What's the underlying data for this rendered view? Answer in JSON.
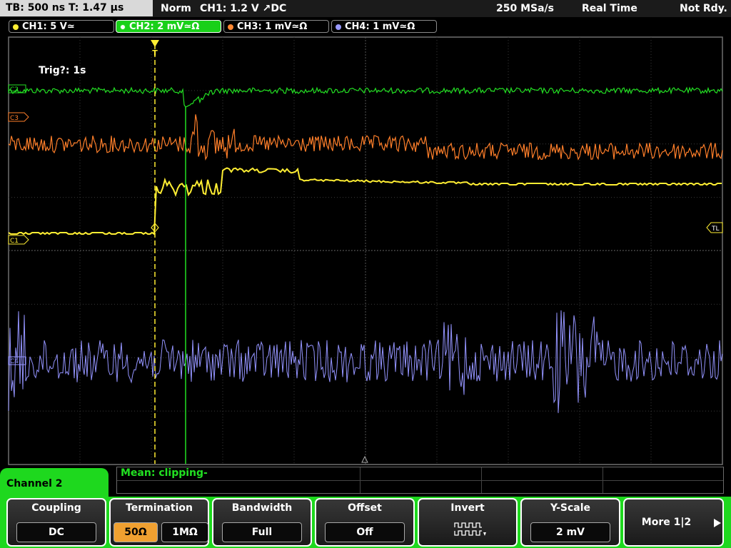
{
  "top": {
    "timebase": "TB: 500 ns   T: 1.47 µs",
    "mode": "Norm",
    "trigger": "CH1: 1.2 V ↗DC",
    "sample_rate": "250 MSa/s",
    "acq": "Real Time",
    "status": "Not Rdy."
  },
  "channels": [
    {
      "label": "CH1: 5 V≃",
      "color": "#ffee33"
    },
    {
      "label": "CH2: 2 mV≃Ω",
      "color": "#22e022"
    },
    {
      "label": "CH3: 1 mV≃Ω",
      "color": "#ff8833"
    },
    {
      "label": "CH4: 1 mV≃Ω",
      "color": "#9999ff"
    }
  ],
  "screen": {
    "trig_text": "Trig?: 1s",
    "c1_marker": "C1",
    "c2_marker": "C2",
    "c3_marker": "C3",
    "c4_marker": "C4",
    "tl_marker": "TL",
    "trigger_marker": "T"
  },
  "panel": {
    "channel_title": "Channel 2",
    "mean": "Mean: clipping-",
    "menus": [
      {
        "title": "Coupling",
        "value": "DC"
      },
      {
        "title": "Termination",
        "value_a": "50Ω",
        "value_b": "1MΩ"
      },
      {
        "title": "Bandwidth",
        "value": "Full"
      },
      {
        "title": "Offset",
        "value": "Off"
      },
      {
        "title": "Invert",
        "icon": "invert-waveform-icon"
      },
      {
        "title": "Y-Scale",
        "value": "2 mV"
      },
      {
        "title": "More 1|2",
        "icon": "next-page-icon"
      }
    ]
  }
}
